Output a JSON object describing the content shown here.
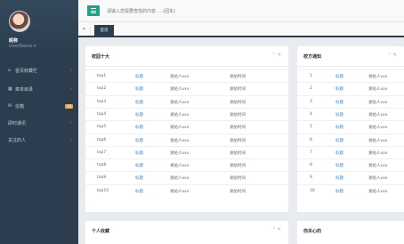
{
  "sidebar": {
    "nickname": "昵称",
    "username": "UserName",
    "items": [
      {
        "icon": "home-icon",
        "glyph": "⌂",
        "label": "首页收藏栏",
        "badge": ""
      },
      {
        "icon": "chart-icon",
        "glyph": "▦",
        "label": "菜单目录",
        "badge": ""
      },
      {
        "icon": "mail-icon",
        "glyph": "✉",
        "label": "信箱",
        "badge": "16"
      },
      {
        "icon": "",
        "glyph": "",
        "label": "即时通讯",
        "badge": ""
      },
      {
        "icon": "",
        "glyph": "",
        "label": "关注的人",
        "badge": ""
      }
    ]
  },
  "topbar": {
    "search_placeholder": "请输入您需要查找的内容 … (回车)"
  },
  "tabs": {
    "prev": "«",
    "home": "首页"
  },
  "panels": {
    "top10": {
      "title": "校园十大",
      "rows": [
        {
          "rank": "top1",
          "title": "标题",
          "poster": "发帖人xxx",
          "time": "发帖时间"
        },
        {
          "rank": "top2",
          "title": "标题",
          "poster": "发帖人xxx",
          "time": "发帖时间"
        },
        {
          "rank": "top3",
          "title": "标题",
          "poster": "发帖人xxx",
          "time": "发帖时间"
        },
        {
          "rank": "top4",
          "title": "标题",
          "poster": "发帖人xxx",
          "time": "发帖时间"
        },
        {
          "rank": "top5",
          "title": "标题",
          "poster": "发帖人xxx",
          "time": "发帖时间"
        },
        {
          "rank": "top6",
          "title": "标题",
          "poster": "发帖人xxx",
          "time": "发帖时间"
        },
        {
          "rank": "top7",
          "title": "标题",
          "poster": "发帖人xxx",
          "time": "发帖时间"
        },
        {
          "rank": "top8",
          "title": "标题",
          "poster": "发帖人xxx",
          "time": "发帖时间"
        },
        {
          "rank": "top9",
          "title": "标题",
          "poster": "发帖人xxx",
          "time": "发帖时间"
        },
        {
          "rank": "top10",
          "title": "标题",
          "poster": "发帖人xxx",
          "time": "发帖时间"
        }
      ]
    },
    "notices": {
      "title": "校方通知",
      "rows": [
        {
          "rank": "1",
          "title": "标题",
          "poster": "发帖人xxx"
        },
        {
          "rank": "2",
          "title": "标题",
          "poster": "发帖人xxx"
        },
        {
          "rank": "3",
          "title": "标题",
          "poster": "发帖人xxx"
        },
        {
          "rank": "4",
          "title": "标题",
          "poster": "发帖人xxx"
        },
        {
          "rank": "5",
          "title": "标题",
          "poster": "发帖人xxx"
        },
        {
          "rank": "6",
          "title": "标题",
          "poster": "发帖人xxx"
        },
        {
          "rank": "7",
          "title": "标题",
          "poster": "发帖人xxx"
        },
        {
          "rank": "8",
          "title": "标题",
          "poster": "发帖人xxx"
        },
        {
          "rank": "9",
          "title": "标题",
          "poster": "发帖人xxx"
        },
        {
          "rank": "10",
          "title": "标题",
          "poster": "发帖人xxx"
        }
      ]
    },
    "favorites": {
      "title": "个人收藏"
    },
    "follows": {
      "title": "你关心的"
    }
  },
  "colors": {
    "sidebar": "#2b3d4f",
    "accent": "#23a085",
    "badge": "#f0a04a",
    "link": "#3a86c8"
  }
}
